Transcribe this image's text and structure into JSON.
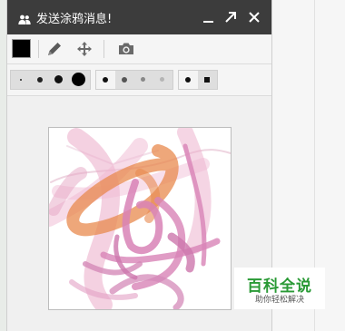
{
  "window": {
    "title": "发送涂鸦消息!",
    "controls": [
      "minimize-icon",
      "expand-icon",
      "close-icon"
    ]
  },
  "toolbar": {
    "current_color": "#000000",
    "tools": [
      "pencil-icon",
      "move-icon",
      "camera-icon"
    ]
  },
  "options": {
    "brush_sizes": {
      "count": 4,
      "selected_index": 2
    },
    "opacity_levels": {
      "count": 4,
      "selected_index": 0
    },
    "shapes": {
      "count": 2,
      "selected_index": 0
    }
  },
  "canvas": {
    "stroke_colors": [
      "#e590bd",
      "#e8894e",
      "#d87fb4"
    ]
  },
  "watermark": {
    "title": "百科全说",
    "subtitle": "助你轻松解决"
  }
}
